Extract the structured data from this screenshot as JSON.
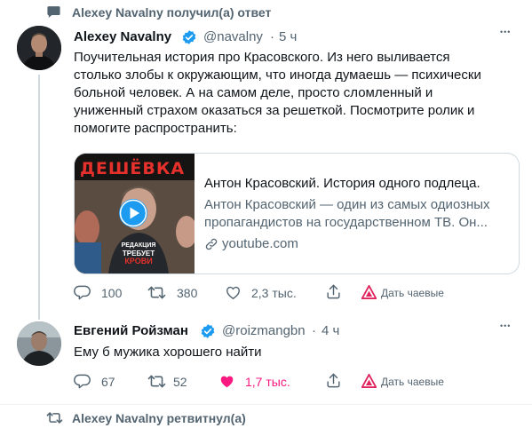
{
  "context_top": {
    "text": "Alexey Navalny получил(а) ответ"
  },
  "tweet1": {
    "author_name": "Alexey Navalny",
    "handle": "@navalny",
    "separator": "·",
    "time": "5 ч",
    "more_label": "•••",
    "lines": [
      "Поучительная история про  Красовского. Из него выливается",
      "столько злобы к окружающим, что иногда думаешь — психически",
      "больной человек. А на самом деле, просто сломленный и",
      "униженный страхом оказаться за решеткой. Посмотрите ролик и",
      "помогите распространить:"
    ],
    "card": {
      "thumb_banner": "ДЕШЁВКА",
      "thumb_shirt_lines": [
        "РЕДАКЦИЯ",
        "ТРЕБУЕТ",
        "КРОВИ"
      ],
      "title": "Антон Красовский. История одного подлеца.",
      "desc_line1": "Антон Красовский — один из самых одиозных",
      "desc_line2": "пропагандистов на государственном ТВ. Он...",
      "domain": "youtube.com"
    },
    "actions": {
      "replies": "100",
      "retweets": "380",
      "likes": "2,3 тыс.",
      "tip": "Дать чаевые"
    }
  },
  "tweet2": {
    "author_name": "Евгений Ройзман",
    "handle": "@roizmangbn",
    "separator": "·",
    "time": "4 ч",
    "more_label": "•••",
    "text": "Ему б мужика хорошего найти",
    "actions": {
      "replies": "67",
      "retweets": "52",
      "likes": "1,7 тыс.",
      "tip": "Дать чаевые"
    }
  },
  "context_bottom": {
    "text": "Alexey Navalny ретвитнул(а)"
  },
  "colors": {
    "verified": "#1d9bf0",
    "like_active": "#f91880",
    "tip_logo": "#e0245e",
    "text_secondary": "#536471"
  }
}
